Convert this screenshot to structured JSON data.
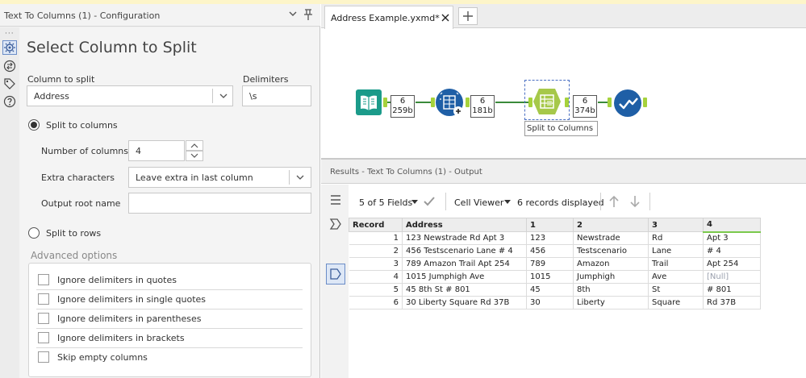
{
  "config_panel": {
    "title": "Text To Columns (1) - Configuration",
    "heading": "Select Column to Split",
    "column_to_split_label": "Column to split",
    "column_to_split_value": "Address",
    "delimiters_label": "Delimiters",
    "delimiters_value": "\\s",
    "split_to_columns_label": "Split to columns",
    "number_of_columns_label": "Number of columns",
    "number_of_columns_value": "4",
    "extra_characters_label": "Extra characters",
    "extra_characters_value": "Leave extra in last column",
    "output_root_name_label": "Output root name",
    "output_root_name_value": "",
    "split_to_rows_label": "Split to rows",
    "advanced_title": "Advanced options",
    "advanced_options": [
      "Ignore delimiters in quotes",
      "Ignore delimiters in single quotes",
      "Ignore delimiters in parentheses",
      "Ignore delimiters in brackets",
      "Skip empty columns"
    ]
  },
  "canvas": {
    "tab_label": "Address Example.yxmd*",
    "badges": [
      {
        "line1": "6",
        "line2": "259b"
      },
      {
        "line1": "6",
        "line2": "181b"
      },
      {
        "line1": "6",
        "line2": "374b"
      }
    ],
    "tool_label": "Split to Columns"
  },
  "results": {
    "title": "Results - Text To Columns (1) - Output",
    "fields_selector": "5 of 5 Fields",
    "viewer": "Cell Viewer",
    "records_displayed": "6 records displayed",
    "columns": [
      "Record",
      "Address",
      "1",
      "2",
      "3",
      "4"
    ],
    "rows": [
      [
        "1",
        "123 Newstrade Rd Apt 3",
        "123",
        "Newstrade",
        "Rd",
        "Apt 3"
      ],
      [
        "2",
        "456 Testscenario Lane # 4",
        "456",
        "Testscenario",
        "Lane",
        "# 4"
      ],
      [
        "3",
        "789 Amazon Trail Apt 254",
        "789",
        "Amazon",
        "Trail",
        "Apt 254"
      ],
      [
        "4",
        "1015 Jumphigh Ave",
        "1015",
        "Jumphigh",
        "Ave",
        "[Null]"
      ],
      [
        "5",
        "45 8th St # 801",
        "45",
        "8th",
        "St",
        "# 801"
      ],
      [
        "6",
        "30 Liberty Square Rd 37B",
        "30",
        "Liberty",
        "Square",
        "Rd 37B"
      ]
    ]
  },
  "colors": {
    "accent_blue": "#1f5fa6",
    "teal_input": "#1b9b8a",
    "connector_green": "#3a8a3a",
    "anchor_green": "#a6d23c",
    "null_text": "#9aa0ad"
  }
}
